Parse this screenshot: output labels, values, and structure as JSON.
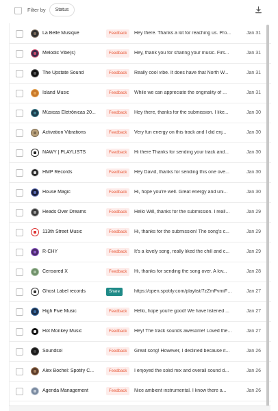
{
  "toolbar": {
    "filter_label": "Filter by",
    "status_chip": "Status",
    "download_icon": "download-icon"
  },
  "colors": {
    "feedback_text": "#e85a3a",
    "feedback_bg": "#fdecea",
    "share_bg": "#1f8a87"
  },
  "rows": [
    {
      "name": "La Belle Musique",
      "badge": "Feedback",
      "badge_type": "feedback",
      "message": "Hey there. Thanks a lot for reaching us. Pro...",
      "date": "Jan 31",
      "avatar": {
        "bg": "#2f2f2f",
        "ring": "#7a6a5a"
      }
    },
    {
      "name": "Melodic Vibe(s)",
      "badge": "Feedback",
      "badge_type": "feedback",
      "message": "Hey, thank you for sharing your music. Firs...",
      "date": "Jan 31",
      "avatar": {
        "bg": "#3b2a4a",
        "ring": "#c94b6b"
      }
    },
    {
      "name": "The Upstate Sound",
      "badge": "Feedback",
      "badge_type": "feedback",
      "message": "Really cool vibe. It does have that North W...",
      "date": "Jan 31",
      "avatar": {
        "bg": "#111111",
        "ring": "#555555"
      }
    },
    {
      "name": "Island Music",
      "badge": "Feedback",
      "badge_type": "feedback",
      "message": "While we can appreciate the originality of ...",
      "date": "Jan 31",
      "avatar": {
        "bg": "#c8782a",
        "ring": "#e3a04e"
      }
    },
    {
      "name": "Músicas Eletrônicas 20...",
      "badge": "Feedback",
      "badge_type": "feedback",
      "message": "Hey there, thanks for the submission. I like...",
      "date": "Jan 30",
      "avatar": {
        "bg": "#1b3b4a",
        "ring": "#3e7d8c"
      }
    },
    {
      "name": "Activation Vibrations",
      "badge": "Feedback",
      "badge_type": "feedback",
      "message": "Very fun energy on this track and I did enj...",
      "date": "Jan 30",
      "avatar": {
        "bg": "#b8a07a",
        "ring": "#7d6a4f"
      }
    },
    {
      "name": "NAWY | PLAYLISTS",
      "badge": "Feedback",
      "badge_type": "feedback",
      "message": "Hi there Thanks for sending your track and...",
      "date": "Jan 30",
      "avatar": {
        "bg": "#ffffff",
        "ring": "#222222"
      }
    },
    {
      "name": "HMP Records",
      "badge": "Feedback",
      "badge_type": "feedback",
      "message": "Hey David, thanks for sending this one ove...",
      "date": "Jan 30",
      "avatar": {
        "bg": "#2a2a2a",
        "ring": "#dddddd"
      }
    },
    {
      "name": "House Magic",
      "badge": "Feedback",
      "badge_type": "feedback",
      "message": "Hi, hope you're well. Great energy and uni...",
      "date": "Jan 30",
      "avatar": {
        "bg": "#1a1f3a",
        "ring": "#5a6ab0"
      }
    },
    {
      "name": "Heads Over Dreams",
      "badge": "Feedback",
      "badge_type": "feedback",
      "message": "Hello Will, thanks for the submission. I reall...",
      "date": "Jan 29",
      "avatar": {
        "bg": "#3a3a3a",
        "ring": "#9a9a9a"
      }
    },
    {
      "name": "113th Street Music",
      "badge": "Feedback",
      "badge_type": "feedback",
      "message": "Hi, thanks for the submission! The song's c...",
      "date": "Jan 29",
      "avatar": {
        "bg": "#ffffff",
        "ring": "#d33"
      }
    },
    {
      "name": "R-CHY",
      "badge": "Feedback",
      "badge_type": "feedback",
      "message": "It's a lovely song, really liked the chill and c...",
      "date": "Jan 29",
      "avatar": {
        "bg": "#4a2a6a",
        "ring": "#8e5ac8"
      }
    },
    {
      "name": "Censored X",
      "badge": "Feedback",
      "badge_type": "feedback",
      "message": "Hi, thanks for sending the song over. A lov...",
      "date": "Jan 28",
      "avatar": {
        "bg": "#6f8f6a",
        "ring": "#a9c3a3"
      }
    },
    {
      "name": "Ghost Label records",
      "badge": "Share",
      "badge_type": "share",
      "message": "https://open.spotify.com/playlist/7zZmPvmiFQ...",
      "date": "Jan 27",
      "avatar": {
        "bg": "#ffffff",
        "ring": "#333333"
      }
    },
    {
      "name": "High Five Music",
      "badge": "Feedback",
      "badge_type": "feedback",
      "message": "Hello, hope you're good! We have listened ...",
      "date": "Jan 27",
      "avatar": {
        "bg": "#1b2f4a",
        "ring": "#3a6aa0"
      }
    },
    {
      "name": "Hot Monkey Music",
      "badge": "Feedback",
      "badge_type": "feedback",
      "message": "Hey! The track sounds awesome! Loved the...",
      "date": "Jan 27",
      "avatar": {
        "bg": "#111111",
        "ring": "#eeeeee"
      }
    },
    {
      "name": "Soundsol",
      "badge": "Feedback",
      "badge_type": "feedback",
      "message": "Great song! However, I declined because it...",
      "date": "Jan 26",
      "avatar": {
        "bg": "#1a1a1a",
        "ring": "#444444"
      }
    },
    {
      "name": "Alex Bochel: Spotify C...",
      "badge": "Feedback",
      "badge_type": "feedback",
      "message": "I enjoyed the solid mix and overall sound d...",
      "date": "Jan 26",
      "avatar": {
        "bg": "#5a3b2a",
        "ring": "#a07a5a"
      }
    },
    {
      "name": "Agenda Management",
      "badge": "Feedback",
      "badge_type": "feedback",
      "message": "Nice ambient instrumental. I know there a...",
      "date": "Jan 26",
      "avatar": {
        "bg": "#7a8aa0",
        "ring": "#c3ccd8"
      }
    }
  ]
}
